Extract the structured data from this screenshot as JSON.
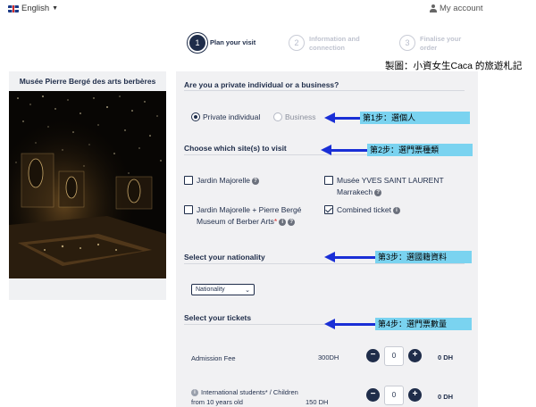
{
  "topbar": {
    "language": "English",
    "account": "My account"
  },
  "steps": [
    {
      "num": "1",
      "label": "Plan your visit"
    },
    {
      "num": "2",
      "label_line1": "Information and",
      "label_line2": "connection"
    },
    {
      "num": "3",
      "label_line1": "Finalise your",
      "label_line2": "order"
    }
  ],
  "watermark": "製圖：小資女生Caca 的旅遊札記",
  "museum": {
    "title": "Musée Pierre Bergé des arts berbères"
  },
  "form": {
    "visitor_type": {
      "title": "Are you a private individual or a business?",
      "options": [
        "Private individual",
        "Business"
      ],
      "selected": "Private individual"
    },
    "sites": {
      "title": "Choose which site(s) to visit",
      "options": [
        {
          "label_line1": "Jardin Majorelle",
          "label_line2": "",
          "checked": false
        },
        {
          "label_line1": "Musée YVES SAINT LAURENT",
          "label_line2": "Marrakech",
          "checked": false
        },
        {
          "label_line1": "Jardin Majorelle + Pierre Bergé",
          "label_line2": "Museum of Berber Arts",
          "checked": false
        },
        {
          "label_line1": "Combined ticket",
          "label_line2": "",
          "checked": true
        }
      ]
    },
    "nationality": {
      "title": "Select your nationality",
      "select_value": "Nationality"
    },
    "tickets": {
      "title": "Select your tickets",
      "rows": [
        {
          "name_line1": "Admission Fee",
          "name_line2": "",
          "price": "300DH",
          "qty": "0",
          "total": "0 DH"
        },
        {
          "name_line1": "International students* / Children",
          "name_line2": "from 10 years old",
          "price": "150 DH",
          "qty": "0",
          "total": "0 DH"
        }
      ]
    }
  },
  "annotations": [
    "第1步：選個人",
    "第2步：選門票種類",
    "第3步：選國籍資料",
    "第4步：選門票數量"
  ],
  "colors": {
    "navy": "#1f2d4a",
    "annotation_arrow": "#1a2fd6",
    "annotation_label": "#7ad3f0",
    "panel_bg": "#f1f1f3"
  }
}
